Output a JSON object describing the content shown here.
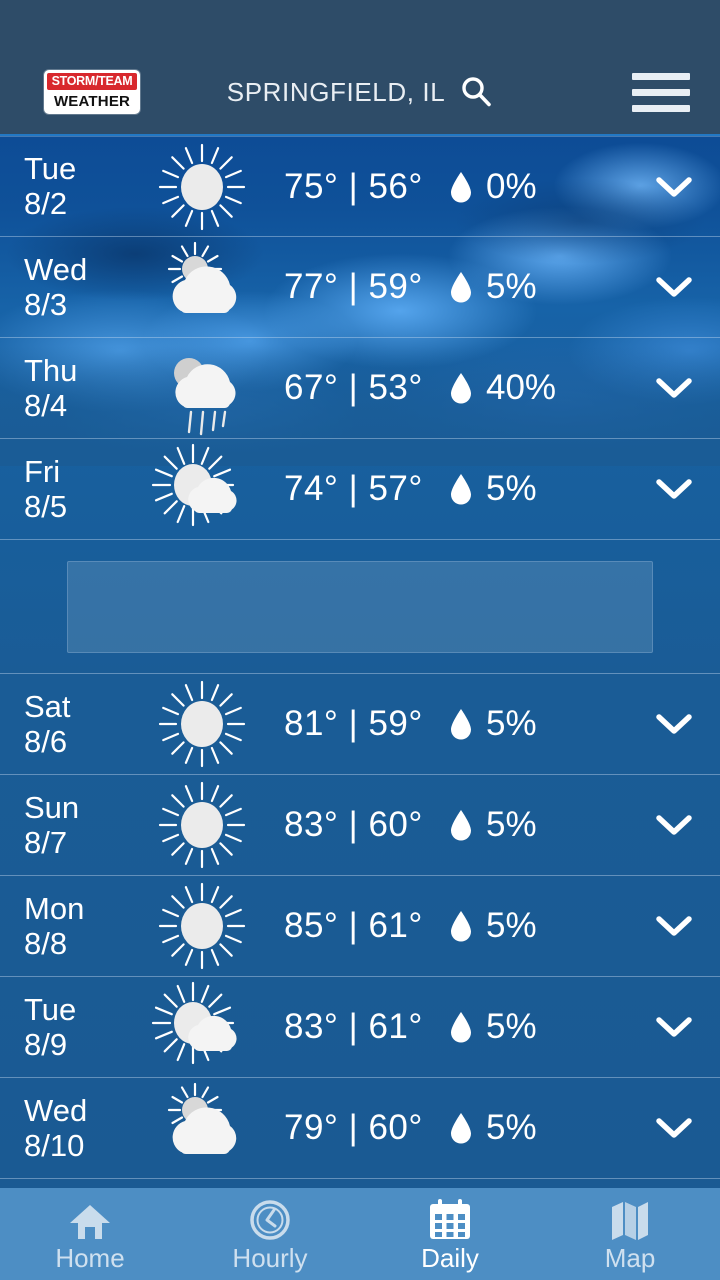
{
  "header": {
    "logo_top": "STORM/TEAM",
    "logo_bottom": "WEATHER",
    "location": "SPRINGFIELD, IL",
    "search_icon": "search-icon",
    "menu_icon": "hamburger-menu-icon",
    "bar_color": "#2e4c68",
    "accent_color": "#d8282d"
  },
  "forecast": {
    "rows": [
      {
        "day": "Tue",
        "date": "8/2",
        "icon": "sunny-icon",
        "temps": "75° | 56°",
        "high": 75,
        "low": 56,
        "pop": "0%",
        "chevron": "chevron-down-icon"
      },
      {
        "day": "Wed",
        "date": "8/3",
        "icon": "partly-cloudy-icon",
        "temps": "77° | 59°",
        "high": 77,
        "low": 59,
        "pop": "5%",
        "chevron": "chevron-down-icon"
      },
      {
        "day": "Thu",
        "date": "8/4",
        "icon": "rain-cloud-icon",
        "temps": "67° | 53°",
        "high": 67,
        "low": 53,
        "pop": "40%",
        "chevron": "chevron-down-icon"
      },
      {
        "day": "Fri",
        "date": "8/5",
        "icon": "sun-small-cloud-icon",
        "temps": "74° | 57°",
        "high": 74,
        "low": 57,
        "pop": "5%",
        "chevron": "chevron-down-icon"
      }
    ],
    "rows_after_ad": [
      {
        "day": "Sat",
        "date": "8/6",
        "icon": "sunny-icon",
        "temps": "81° | 59°",
        "high": 81,
        "low": 59,
        "pop": "5%",
        "chevron": "chevron-down-icon"
      },
      {
        "day": "Sun",
        "date": "8/7",
        "icon": "sunny-icon",
        "temps": "83° | 60°",
        "high": 83,
        "low": 60,
        "pop": "5%",
        "chevron": "chevron-down-icon"
      },
      {
        "day": "Mon",
        "date": "8/8",
        "icon": "sunny-icon",
        "temps": "85° | 61°",
        "high": 85,
        "low": 61,
        "pop": "5%",
        "chevron": "chevron-down-icon"
      },
      {
        "day": "Tue",
        "date": "8/9",
        "icon": "sun-small-cloud-icon",
        "temps": "83° | 61°",
        "high": 83,
        "low": 61,
        "pop": "5%",
        "chevron": "chevron-down-icon"
      },
      {
        "day": "Wed",
        "date": "8/10",
        "icon": "partly-cloudy-icon",
        "temps": "79° | 60°",
        "high": 79,
        "low": 60,
        "pop": "5%",
        "chevron": "chevron-down-icon"
      }
    ],
    "pop_icon": "water-droplet-icon"
  },
  "ad": {
    "slot_label": ""
  },
  "bottom_nav": {
    "items": [
      {
        "label": "Home",
        "icon": "home-icon",
        "active": false
      },
      {
        "label": "Hourly",
        "icon": "clock-icon",
        "active": false
      },
      {
        "label": "Daily",
        "icon": "calendar-icon",
        "active": true
      },
      {
        "label": "Map",
        "icon": "map-icon",
        "active": false
      }
    ],
    "bar_color": "#4d8ec4"
  }
}
